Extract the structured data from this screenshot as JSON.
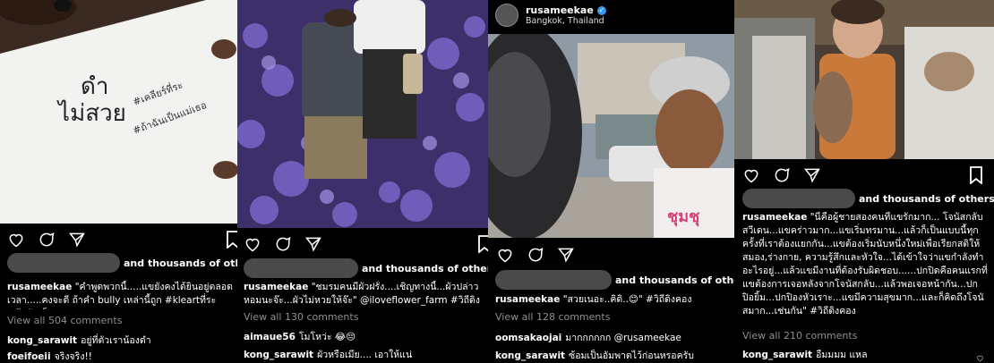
{
  "panels": [
    {
      "liked_by_suffix": "and thousands of others",
      "caption_user": "rusameekae",
      "caption_text": "\"คำพูดพวกนี้.....แขยังคงได้ยินอยู่ตลอดเวลา.....คงจะดี ถ้าคำ bully เหล่านี้ถูก #kleartที่ระ #ถ้าฉันเป็นแม่เธอ",
      "view_all": "View all 504 comments",
      "comments": [
        {
          "user": "kong_sarawit",
          "text": "อยู่ที่ตัวเราน้องดำ"
        },
        {
          "user": "foeifoeii",
          "text": "จริงจริง!!"
        }
      ],
      "photo_handwriting": [
        "ดำ",
        "ไม่สวย",
        "#เคลียร์ที่ระ",
        "#ถ้าฉันเป็นแม่เธอ"
      ]
    },
    {
      "liked_by_suffix": "and thousands of others",
      "caption_user": "rusameekae",
      "caption_text": "\"ชมรมคนมีผัวฝรั่ง....เชิญทางนี้...ผัวปล่าวหอมนะจ๊ะ...ผัวไม่หวยให้จ๊ะ\" @iloveflower_farm #วิถีดิงคอง",
      "view_all": "View all 130 comments",
      "comments": [
        {
          "user": "aimaue56",
          "text": "โมโหว่ะ 😂😔"
        },
        {
          "user": "kong_sarawit",
          "text": "ผัวหรือเมีย.... เอาให้แน่"
        }
      ]
    },
    {
      "header_user": "rusameekae",
      "header_location": "Bangkok, Thailand",
      "liked_by_suffix": "and thousands of others",
      "caption_user": "rusameekae",
      "caption_text": "\"สวยเนอะ..คิดิ..😊\" #วิถีดิงคอง",
      "view_all": "View all 128 comments",
      "comments": [
        {
          "user": "oomsakaojai",
          "text": "มากกกกกก @rusameekae"
        },
        {
          "user": "kong_sarawit",
          "text": "ซ้อมเป็นอัมพาตไว้ก่อนหรอครับ"
        }
      ]
    },
    {
      "liked_by_suffix": "and thousands of others",
      "caption_user": "rusameekae",
      "caption_text": "\"นี่คือผู้ชายสองคนที่แขรักมาก... โจนัสกลับสวีเดน...แขคร่าวมาก...แขเริ่มทรมาน...แล้วก็เป็นแบบนี้ทุกครั้งที่เราต้องแยกกัน...แขต้องเริ่มนับหนึ่งใหม่เพื่อเรียกสติให้สมอง,ร่างกาย, ความรู้สึกและหัวใจ...ได้เข้าใจว่าแขกำลังทำอะไรอยู่...แล้วแขมีงานที่ต้องรับผิดชอบ......ปกปิดคือคนแรกที่แขต้องการเจอหลังจากโจนัสกลับ...แล้วพอเจอหน้ากัน...ปกปิอยิ้ม...ปกปิองหัวเราะ...แขมีความสุขมาก...และก็คิดถึงโจนัสมาก...เช่นกัน\" #วิถีดิงคอง",
      "view_all": "View all 210 comments",
      "comments": [
        {
          "user": "kong_sarawit",
          "text": "อืมมมม แหล"
        }
      ]
    }
  ]
}
